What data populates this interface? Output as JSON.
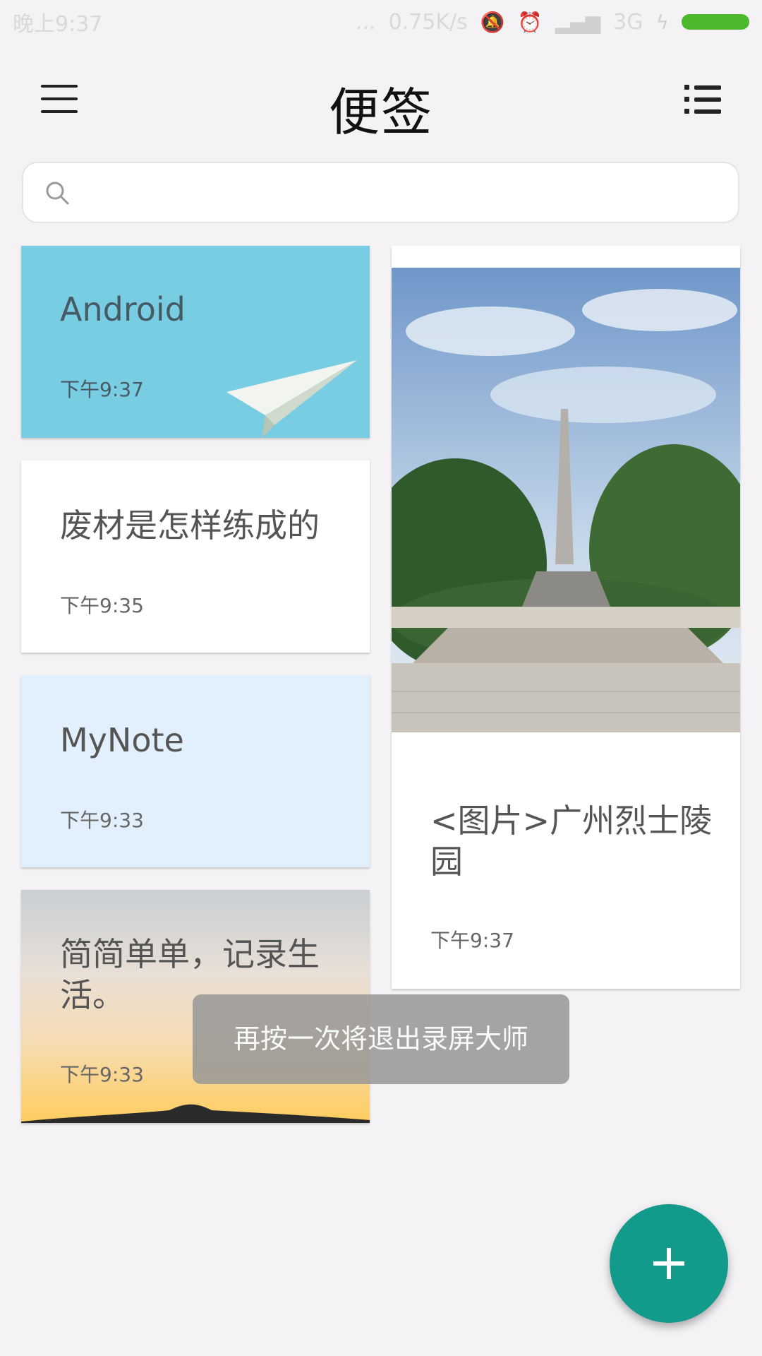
{
  "status_bar": {
    "time": "晚上9:37",
    "dots": "...",
    "speed": "0.75K/s",
    "network": "3G",
    "icons": [
      "bell-off-icon",
      "alarm-icon",
      "signal-icon",
      "battery-icon"
    ]
  },
  "toolbar": {
    "title": "便签",
    "menu_icon": "menu-icon",
    "list_icon": "list-view-icon"
  },
  "search": {
    "placeholder": ""
  },
  "notes": [
    {
      "title": "Android",
      "time": "下午9:37",
      "color": "#78cde3",
      "decoration": "paper-plane"
    },
    {
      "title": "废材是怎样练成的",
      "time": "下午9:35",
      "color": "#ffffff"
    },
    {
      "title": "MyNote",
      "time": "下午9:33",
      "color": "#e1f0fc"
    },
    {
      "title": "简简单单，记录生活。",
      "time": "下午9:33",
      "color": "sunset-gradient"
    },
    {
      "title": "<图片>广州烈士陵园",
      "time": "下午9:37",
      "color": "#ffffff",
      "image": "monument-photo"
    }
  ],
  "toast": "再按一次将退出录屏大师",
  "fab": {
    "icon": "plus-icon",
    "color": "#129a8b"
  }
}
